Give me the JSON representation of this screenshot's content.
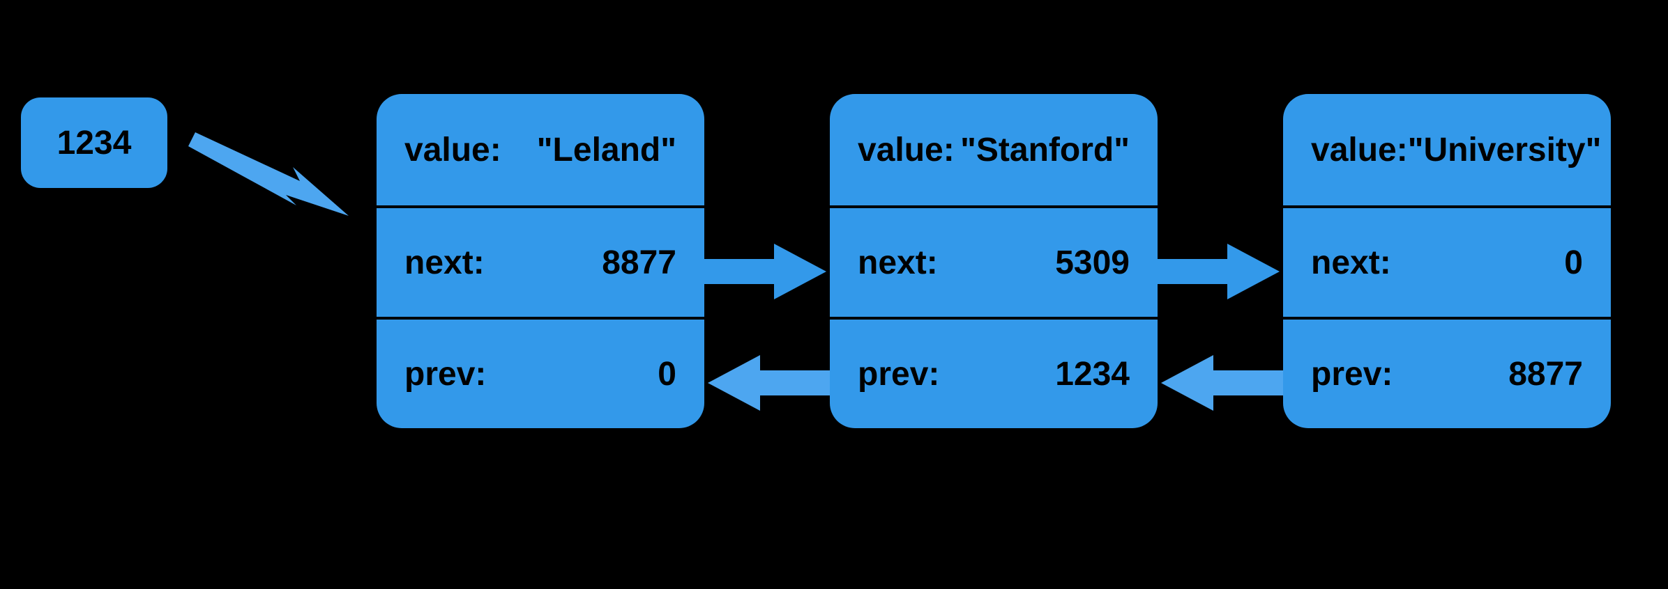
{
  "head": {
    "address": "1234"
  },
  "fields": {
    "value": "value:",
    "next": "next:",
    "prev": "prev:"
  },
  "nodes": [
    {
      "value": "\"Leland\"",
      "next": "8877",
      "prev": "0"
    },
    {
      "value": "\"Stanford\"",
      "next": "5309",
      "prev": "1234"
    },
    {
      "value": "\"University\"",
      "next": "0",
      "prev": "8877"
    }
  ]
}
